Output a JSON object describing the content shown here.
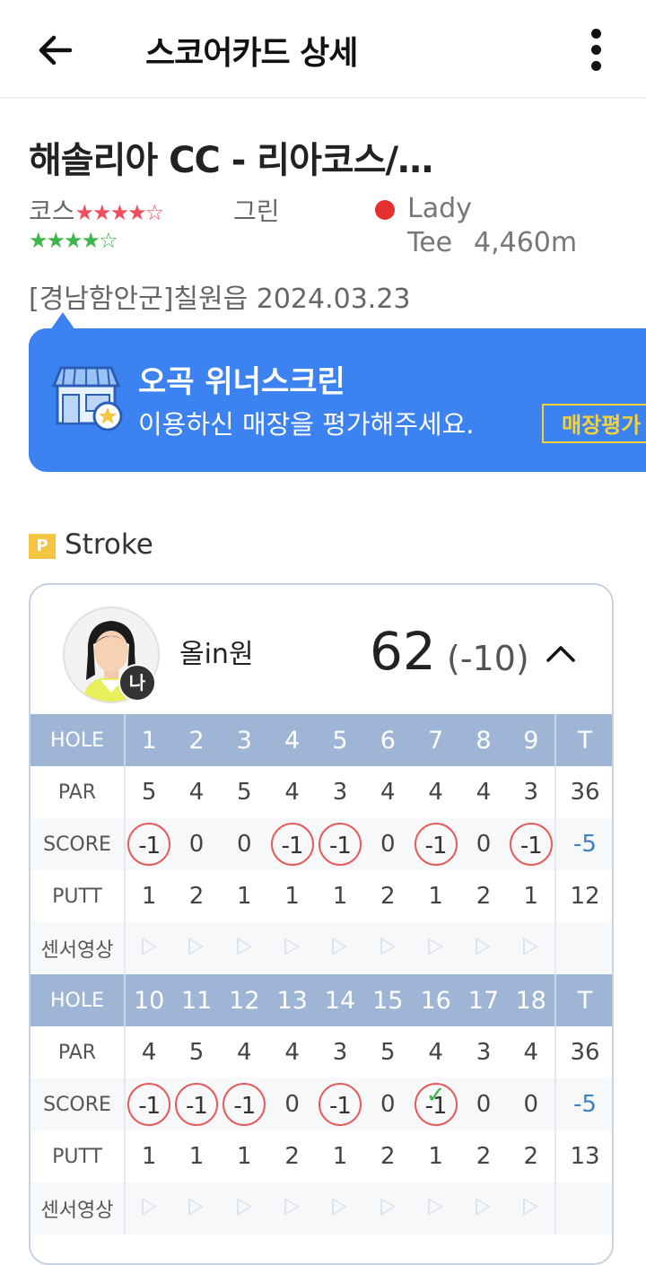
{
  "header": {
    "title": "스코어카드 상세"
  },
  "course": {
    "name": "해솔리아 CC - 리아코스/…",
    "course_label": "코스",
    "course_rating": 4,
    "course_rating_max": 5,
    "green_label": "그린",
    "green_rating": 4,
    "green_rating_max": 5,
    "tee_color": "#e53030",
    "tee_name": "Lady",
    "tee_label": "Tee",
    "tee_distance": "4,460m",
    "location_date": "[경남함안군]칠원읍 2024.03.23"
  },
  "banner": {
    "store_name": "오곡 위너스크린",
    "description": "이용하신 매장을 평가해주세요.",
    "rate_button": "매장평가",
    "icon": "store-icon"
  },
  "mode": {
    "badge": "P",
    "label": "Stroke"
  },
  "player": {
    "name": "올in원",
    "me_badge": "나",
    "total": "62",
    "diff": "(-10)"
  },
  "scorecard": {
    "labels": {
      "hole": "HOLE",
      "par": "PAR",
      "score": "SCORE",
      "putt": "PUTT",
      "video": "센서영상",
      "total": "T"
    },
    "front": {
      "holes": [
        "1",
        "2",
        "3",
        "4",
        "5",
        "6",
        "7",
        "8",
        "9"
      ],
      "par": [
        "5",
        "4",
        "5",
        "4",
        "3",
        "4",
        "4",
        "4",
        "3"
      ],
      "score": [
        "-1",
        "0",
        "0",
        "-1",
        "-1",
        "0",
        "-1",
        "0",
        "-1"
      ],
      "putt": [
        "1",
        "2",
        "1",
        "1",
        "1",
        "2",
        "1",
        "2",
        "1"
      ],
      "par_total": "36",
      "score_total": "-5",
      "putt_total": "12"
    },
    "back": {
      "holes": [
        "10",
        "11",
        "12",
        "13",
        "14",
        "15",
        "16",
        "17",
        "18"
      ],
      "par": [
        "4",
        "5",
        "4",
        "4",
        "3",
        "5",
        "4",
        "3",
        "4"
      ],
      "score": [
        "-1",
        "-1",
        "-1",
        "0",
        "-1",
        "0",
        "-1",
        "0",
        "0"
      ],
      "putt": [
        "1",
        "1",
        "1",
        "2",
        "1",
        "2",
        "1",
        "2",
        "2"
      ],
      "par_total": "36",
      "score_total": "-5",
      "putt_total": "13"
    }
  }
}
